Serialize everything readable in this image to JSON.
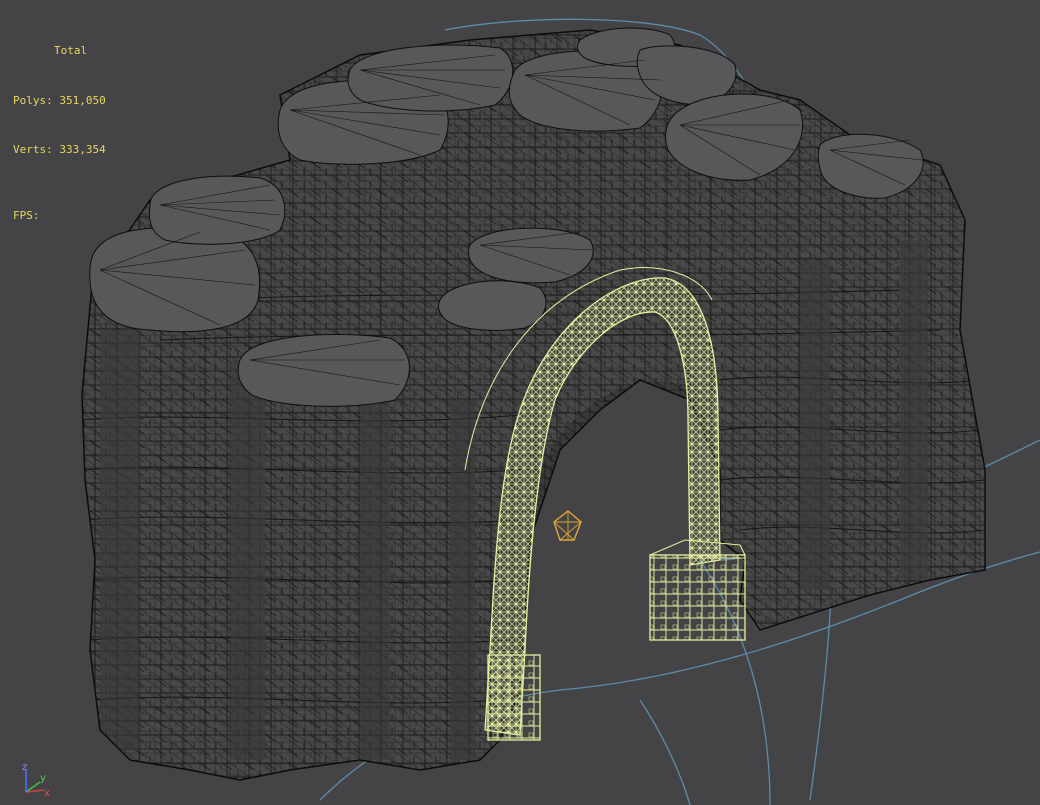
{
  "viewport": {
    "stats": {
      "title": "Total",
      "polys_label": "Polys:",
      "polys_value": "351,050",
      "verts_label": "Verts:",
      "verts_value": "333,354",
      "fps_label": "FPS:"
    },
    "axis": {
      "x_label": "x",
      "y_label": "y",
      "z_label": "z"
    },
    "colors": {
      "background": "#444446",
      "rock_fill": "#4a4a4c",
      "rock_top": "#575759",
      "wire": "#111111",
      "selection_wire": "#e6efa0",
      "guide_curve": "#5f8aa8",
      "stats_text": "#e8d860",
      "axis_x": "#d04040",
      "axis_y": "#40c040",
      "axis_z": "#5070ff"
    },
    "icons": [
      "pivot-gizmo-icon",
      "axis-tripod-icon"
    ]
  }
}
